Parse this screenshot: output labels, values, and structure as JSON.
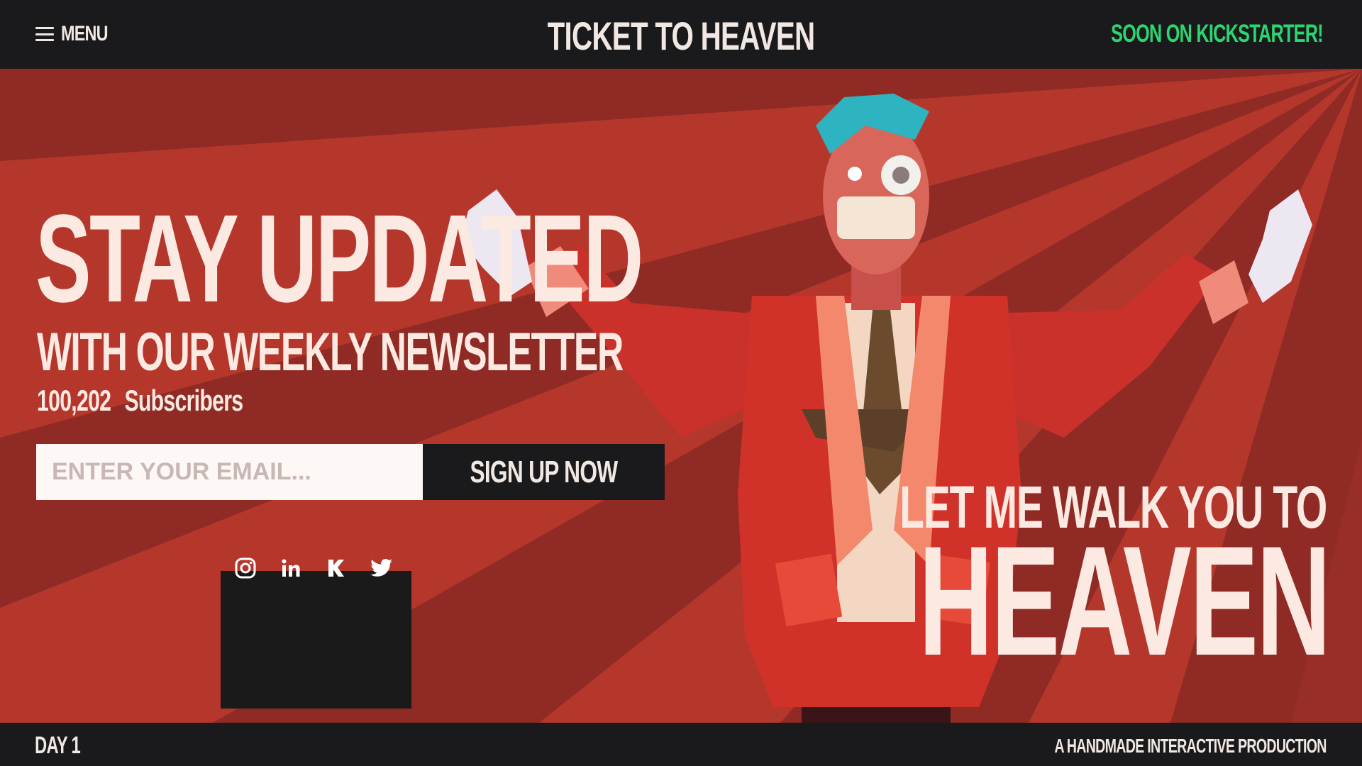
{
  "header": {
    "menu_label": "MENU",
    "site_title": "TICKET TO HEAVEN",
    "kickstarter_link": "SOON ON KICKSTARTER!"
  },
  "newsletter": {
    "headline": "STAY UPDATED",
    "subheadline": "WITH OUR WEEKLY NEWSLETTER",
    "subscriber_count": "100,202",
    "subscriber_label": "Subscribers",
    "email_placeholder": "ENTER YOUR EMAIL...",
    "email_value": "",
    "signup_button": "SIGN UP NOW"
  },
  "social_links": [
    {
      "icon": "instagram-icon"
    },
    {
      "icon": "linkedin-icon"
    },
    {
      "icon": "kickstarter-icon"
    },
    {
      "icon": "twitter-icon"
    }
  ],
  "tagline": {
    "line1": "LET ME WALK YOU TO",
    "line2": "HEAVEN"
  },
  "footer": {
    "day_label": "DAY 1",
    "credit": "A HANDMADE INTERACTIVE PRODUCTION"
  },
  "colors": {
    "bar_background": "#1a1a1c",
    "hero_red": "#b5372c",
    "hero_dark_red": "#8f2b24",
    "accent_green": "#2bd670",
    "text_cream": "#fbe9e2"
  }
}
